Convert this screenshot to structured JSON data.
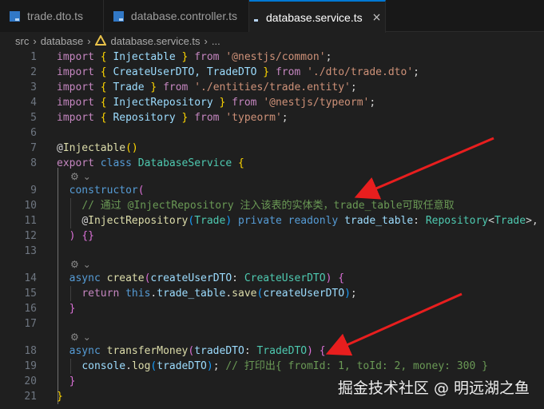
{
  "tabs": [
    {
      "label": "trade.dto.ts",
      "active": false
    },
    {
      "label": "database.controller.ts",
      "active": false
    },
    {
      "label": "database.service.ts",
      "active": true
    }
  ],
  "tab_close_glyph": "×",
  "breadcrumb": {
    "items": [
      "src",
      "database",
      "database.service.ts",
      "..."
    ]
  },
  "code_lines": [
    {
      "n": "1",
      "tokens": [
        [
          "import",
          "kw"
        ],
        [
          " ",
          "plain"
        ],
        [
          "{",
          "br1"
        ],
        [
          " Injectable ",
          "id"
        ],
        [
          "}",
          "br1"
        ],
        [
          " ",
          "plain"
        ],
        [
          "from",
          "kw"
        ],
        [
          " ",
          "plain"
        ],
        [
          "'@nestjs/common'",
          "str"
        ],
        [
          ";",
          "plain"
        ]
      ]
    },
    {
      "n": "2",
      "tokens": [
        [
          "import",
          "kw"
        ],
        [
          " ",
          "plain"
        ],
        [
          "{",
          "br1"
        ],
        [
          " CreateUserDTO, TradeDTO ",
          "id"
        ],
        [
          "}",
          "br1"
        ],
        [
          " ",
          "plain"
        ],
        [
          "from",
          "kw"
        ],
        [
          " ",
          "plain"
        ],
        [
          "'./dto/trade.dto'",
          "str"
        ],
        [
          ";",
          "plain"
        ]
      ]
    },
    {
      "n": "3",
      "tokens": [
        [
          "import",
          "kw"
        ],
        [
          " ",
          "plain"
        ],
        [
          "{",
          "br1"
        ],
        [
          " Trade ",
          "id"
        ],
        [
          "}",
          "br1"
        ],
        [
          " ",
          "plain"
        ],
        [
          "from",
          "kw"
        ],
        [
          " ",
          "plain"
        ],
        [
          "'./entities/trade.entity'",
          "str"
        ],
        [
          ";",
          "plain"
        ]
      ]
    },
    {
      "n": "4",
      "tokens": [
        [
          "import",
          "kw"
        ],
        [
          " ",
          "plain"
        ],
        [
          "{",
          "br1"
        ],
        [
          " InjectRepository ",
          "id"
        ],
        [
          "}",
          "br1"
        ],
        [
          " ",
          "plain"
        ],
        [
          "from",
          "kw"
        ],
        [
          " ",
          "plain"
        ],
        [
          "'@nestjs/typeorm'",
          "str"
        ],
        [
          ";",
          "plain"
        ]
      ]
    },
    {
      "n": "5",
      "tokens": [
        [
          "import",
          "kw"
        ],
        [
          " ",
          "plain"
        ],
        [
          "{",
          "br1"
        ],
        [
          " Repository ",
          "id"
        ],
        [
          "}",
          "br1"
        ],
        [
          " ",
          "plain"
        ],
        [
          "from",
          "kw"
        ],
        [
          " ",
          "plain"
        ],
        [
          "'typeorm'",
          "str"
        ],
        [
          ";",
          "plain"
        ]
      ]
    },
    {
      "n": "6",
      "tokens": []
    },
    {
      "n": "7",
      "tokens": [
        [
          "@",
          "plain"
        ],
        [
          "Injectable",
          "fn"
        ],
        [
          "()",
          "br1"
        ]
      ]
    },
    {
      "n": "8",
      "tokens": [
        [
          "export",
          "kw"
        ],
        [
          " ",
          "plain"
        ],
        [
          "class",
          "blue"
        ],
        [
          " ",
          "plain"
        ],
        [
          "DatabaseService",
          "cls"
        ],
        [
          " ",
          "plain"
        ],
        [
          "{",
          "br1"
        ]
      ]
    },
    {
      "n": "9",
      "tokens": [
        [
          "  ",
          "plain"
        ],
        [
          "constructor",
          "blue"
        ],
        [
          "(",
          "br2"
        ]
      ]
    },
    {
      "n": "10",
      "tokens": [
        [
          "    ",
          "plain"
        ],
        [
          "// 通过 @InjectRepository 注入该表的实体类，trade_table可取任意取",
          "cm"
        ]
      ]
    },
    {
      "n": "11",
      "tokens": [
        [
          "    ",
          "plain"
        ],
        [
          "@",
          "plain"
        ],
        [
          "InjectRepository",
          "fn"
        ],
        [
          "(",
          "br3"
        ],
        [
          "Trade",
          "cls"
        ],
        [
          ")",
          "br3"
        ],
        [
          " ",
          "plain"
        ],
        [
          "private",
          "blue"
        ],
        [
          " ",
          "plain"
        ],
        [
          "readonly",
          "blue"
        ],
        [
          " ",
          "plain"
        ],
        [
          "trade_table",
          "id"
        ],
        [
          ": ",
          "plain"
        ],
        [
          "Repository",
          "cls"
        ],
        [
          "<",
          "plain"
        ],
        [
          "Trade",
          "cls"
        ],
        [
          ">,",
          "plain"
        ]
      ]
    },
    {
      "n": "12",
      "tokens": [
        [
          "  ",
          "plain"
        ],
        [
          ")",
          "br2"
        ],
        [
          " ",
          "plain"
        ],
        [
          "{}",
          "br2"
        ]
      ]
    },
    {
      "n": "13",
      "tokens": []
    },
    {
      "n": "14",
      "tokens": [
        [
          "  ",
          "plain"
        ],
        [
          "async",
          "blue"
        ],
        [
          " ",
          "plain"
        ],
        [
          "create",
          "fn"
        ],
        [
          "(",
          "br2"
        ],
        [
          "createUserDTO",
          "id"
        ],
        [
          ": ",
          "plain"
        ],
        [
          "CreateUserDTO",
          "cls"
        ],
        [
          ")",
          "br2"
        ],
        [
          " ",
          "plain"
        ],
        [
          "{",
          "br2"
        ]
      ]
    },
    {
      "n": "15",
      "tokens": [
        [
          "    ",
          "plain"
        ],
        [
          "return",
          "ctl"
        ],
        [
          " ",
          "plain"
        ],
        [
          "this",
          "blue"
        ],
        [
          ".",
          "plain"
        ],
        [
          "trade_table",
          "id"
        ],
        [
          ".",
          "plain"
        ],
        [
          "save",
          "fn"
        ],
        [
          "(",
          "br3"
        ],
        [
          "createUserDTO",
          "id"
        ],
        [
          ")",
          "br3"
        ],
        [
          ";",
          "plain"
        ]
      ]
    },
    {
      "n": "16",
      "tokens": [
        [
          "  ",
          "plain"
        ],
        [
          "}",
          "br2"
        ]
      ]
    },
    {
      "n": "17",
      "tokens": []
    },
    {
      "n": "18",
      "tokens": [
        [
          "  ",
          "plain"
        ],
        [
          "async",
          "blue"
        ],
        [
          " ",
          "plain"
        ],
        [
          "transferMoney",
          "fn"
        ],
        [
          "(",
          "br2"
        ],
        [
          "tradeDTO",
          "id"
        ],
        [
          ": ",
          "plain"
        ],
        [
          "TradeDTO",
          "cls"
        ],
        [
          ")",
          "br2"
        ],
        [
          " ",
          "plain"
        ],
        [
          "{",
          "br2"
        ]
      ]
    },
    {
      "n": "19",
      "tokens": [
        [
          "    ",
          "plain"
        ],
        [
          "console",
          "id"
        ],
        [
          ".",
          "plain"
        ],
        [
          "log",
          "fn"
        ],
        [
          "(",
          "br3"
        ],
        [
          "tradeDTO",
          "id"
        ],
        [
          ")",
          "br3"
        ],
        [
          "; ",
          "plain"
        ],
        [
          "// 打印出{ fromId: 1, toId: 2, money: 300 }",
          "cm"
        ]
      ]
    },
    {
      "n": "20",
      "tokens": [
        [
          "  ",
          "plain"
        ],
        [
          "}",
          "br2"
        ]
      ]
    },
    {
      "n": "21",
      "tokens": [
        [
          "}",
          "br1"
        ]
      ]
    }
  ],
  "code_lens_glyph": "⚙",
  "watermark": "掘金技术社区 @ 明远湖之鱼",
  "colors": {
    "arrow": "#e81e1e",
    "accent": "#0078d4"
  }
}
